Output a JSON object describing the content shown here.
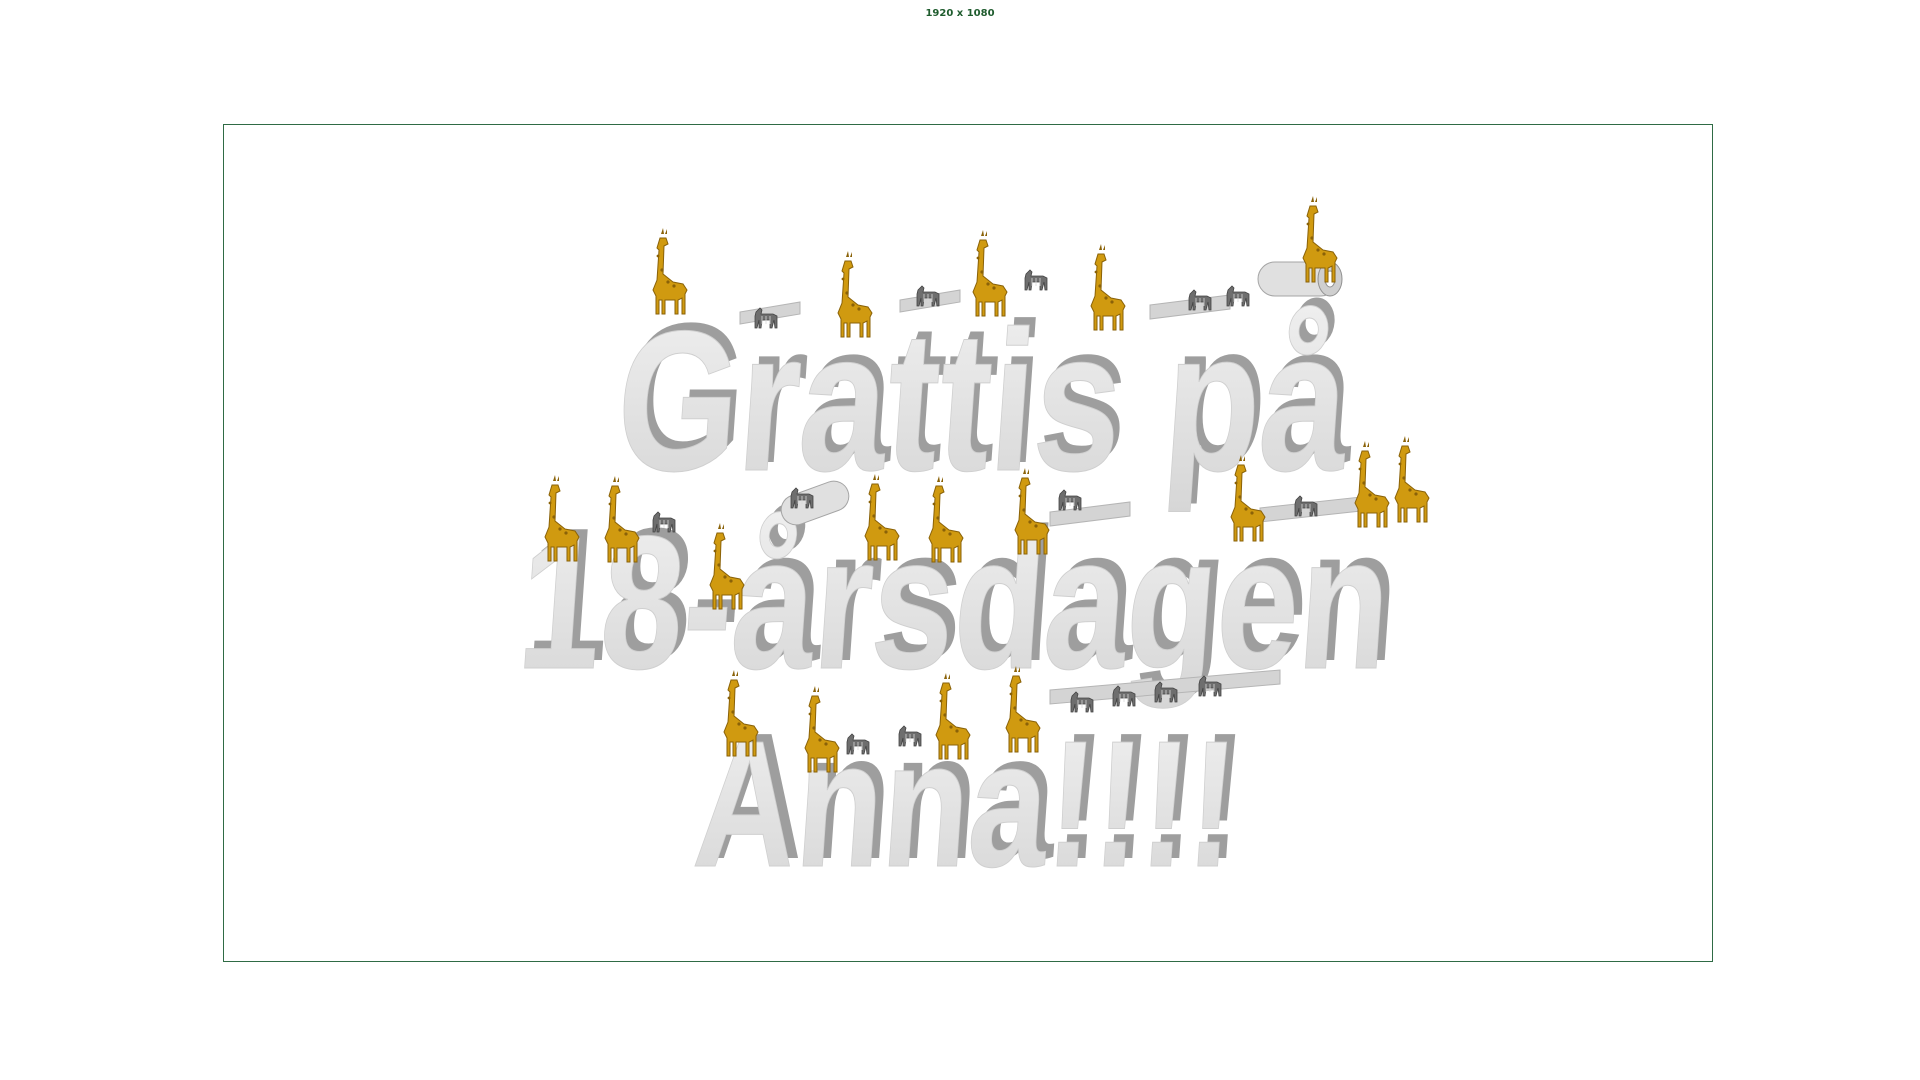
{
  "dimension_label": "1920 x 1080",
  "scene": {
    "lines": [
      "Grattis på",
      "18-årsdagen",
      "Anna!!!!"
    ],
    "colors": {
      "letter_face": "#e6e6e6",
      "letter_side": "#a8a8a8",
      "letter_top": "#d0d0d0",
      "giraffe": "#d09a10",
      "zebra": "#6e6e6e",
      "frame": "#2f6b45"
    }
  }
}
